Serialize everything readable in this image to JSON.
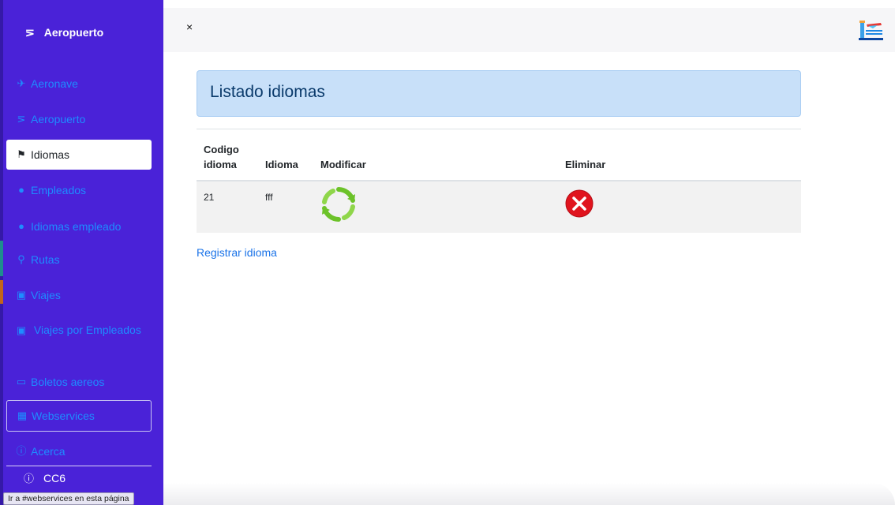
{
  "brand": {
    "icon": "departure-icon",
    "title": "Aeropuerto"
  },
  "sidebar": {
    "items": [
      {
        "icon": "plane-icon",
        "glyph": "✈",
        "label": "Aeronave"
      },
      {
        "icon": "departure-icon",
        "glyph": "⋝",
        "label": "Aeropuerto"
      },
      {
        "icon": "flag-icon",
        "glyph": "⚑",
        "label": "Idiomas",
        "active": true
      },
      {
        "icon": "user-circle-icon",
        "glyph": "●",
        "label": "Empleados"
      },
      {
        "icon": "user-circle-icon",
        "glyph": "●",
        "label": "Idiomas empleado"
      },
      {
        "icon": "map-marker-icon",
        "glyph": "⚲",
        "label": "Rutas"
      },
      {
        "icon": "suitcase-icon",
        "glyph": "▣",
        "label": "Viajes"
      },
      {
        "icon": "suitcase-icon",
        "glyph": "▣",
        "label": "Viajes por Empleados"
      },
      {
        "icon": "money-icon",
        "glyph": "▭",
        "label": "Boletos aereos"
      },
      {
        "icon": "grid-icon",
        "glyph": "▦",
        "label": "Webservices",
        "outlined": true
      },
      {
        "icon": "info-icon",
        "glyph": "ⓘ",
        "label": "Acerca"
      }
    ],
    "footer": {
      "icon": "info-icon",
      "glyph": "ⓘ",
      "label": "CC6"
    }
  },
  "topbar": {
    "close_label": "×",
    "logo_icon": "airport-logo-icon"
  },
  "main": {
    "title": "Listado idiomas",
    "table": {
      "headers": [
        "Codigo idioma",
        "Idioma",
        "Modificar",
        "Eliminar"
      ],
      "rows": [
        {
          "codigo": "21",
          "idioma": "fff",
          "modify_icon": "refresh-icon",
          "delete_icon": "delete-icon"
        }
      ]
    },
    "register_link": "Registrar idioma"
  },
  "status_bar": "Ir a #webservices en esta página",
  "colors": {
    "sidebar_bg": "#4a22d8",
    "nav_link": "#1e8cff",
    "header_bg": "#c8e0f9",
    "header_text": "#0a3a6b",
    "link": "#1a73e8",
    "refresh_green": "#6cc229",
    "delete_red": "#e0141e"
  }
}
